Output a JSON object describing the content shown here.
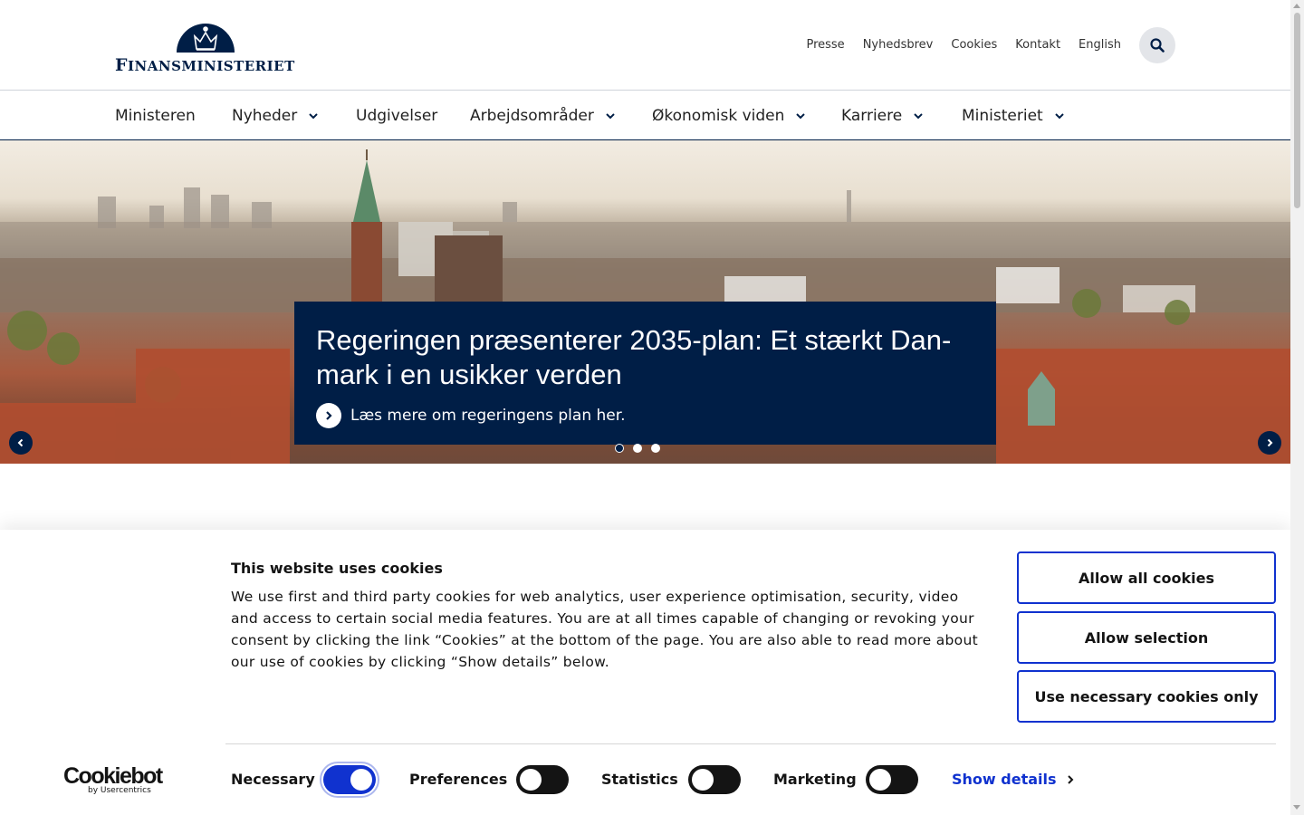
{
  "logo": {
    "text": "Finansministeriet"
  },
  "top_links": [
    "Presse",
    "Nyhedsbrev",
    "Cookies",
    "Kontakt",
    "English"
  ],
  "nav": {
    "items": [
      {
        "label": "Ministeren",
        "has_dropdown": false
      },
      {
        "label": "Nyheder",
        "has_dropdown": true
      },
      {
        "label": "Udgivelser",
        "has_dropdown": false
      },
      {
        "label": "Arbejdsområder",
        "has_dropdown": true
      },
      {
        "label": "Økonomisk viden",
        "has_dropdown": true
      },
      {
        "label": "Karriere",
        "has_dropdown": true
      },
      {
        "label": "Ministeriet",
        "has_dropdown": true
      }
    ]
  },
  "hero": {
    "title": "Regeringen præsenterer 2035-plan: Et stærkt Dan­mark i en usikker verden",
    "link_label": "Læs mere om regeringens plan her.",
    "slide_count": 3,
    "active_slide": 1
  },
  "cookie": {
    "title": "This website uses cookies",
    "text": "We use first and third party cookies for web analytics, user experience optimisation, security, video and access to certain social media features. You are at all times capable of changing or revoking your consent by clicking the link “Cookies” at the bottom of the page. You are also able to read more about our use of cookies by clicking “Show details” below.",
    "buttons": {
      "allow_all": "Allow all cookies",
      "allow_selection": "Allow selection",
      "necessary_only": "Use necessary cookies only"
    },
    "toggles": [
      {
        "label": "Necessary",
        "on": true
      },
      {
        "label": "Preferences",
        "on": false
      },
      {
        "label": "Statistics",
        "on": false
      },
      {
        "label": "Marketing",
        "on": false
      }
    ],
    "show_details": "Show details",
    "brand": "Cookiebot",
    "brand_sub": "by Usercentrics"
  },
  "colors": {
    "navy": "#001e46",
    "cookie_blue": "#1032cf"
  }
}
